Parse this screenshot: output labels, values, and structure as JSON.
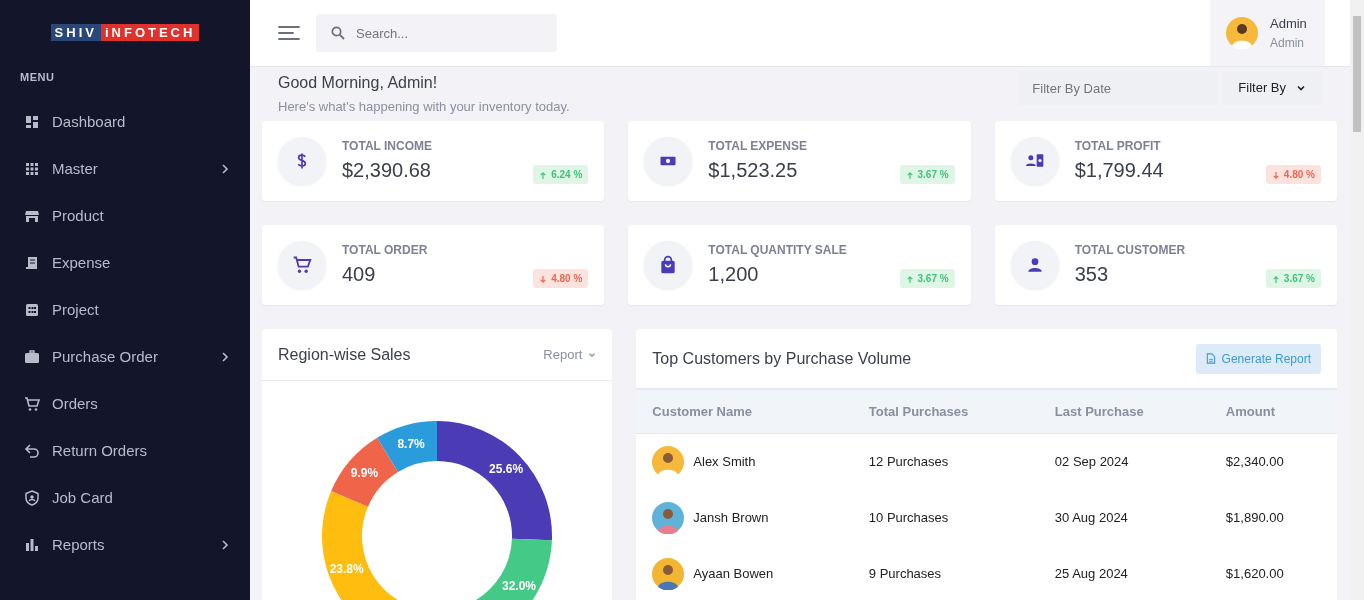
{
  "sidebar": {
    "logo": {
      "left": "SHIV",
      "right": "iNFOTECH"
    },
    "section": "MENU",
    "items": [
      {
        "label": "Dashboard",
        "submenu": false
      },
      {
        "label": "Master",
        "submenu": true
      },
      {
        "label": "Product",
        "submenu": false
      },
      {
        "label": "Expense",
        "submenu": false
      },
      {
        "label": "Project",
        "submenu": false
      },
      {
        "label": "Purchase Order",
        "submenu": true
      },
      {
        "label": "Orders",
        "submenu": false
      },
      {
        "label": "Return Orders",
        "submenu": false
      },
      {
        "label": "Job Card",
        "submenu": false
      },
      {
        "label": "Reports",
        "submenu": true
      }
    ]
  },
  "header": {
    "search": {
      "placeholder": "Search..."
    },
    "user": {
      "name": "Admin",
      "role": "Admin"
    }
  },
  "greeting": {
    "title": "Good Morning, Admin!",
    "subtitle": "Here's what's happening with your inventory today.",
    "date_filter": {
      "placeholder": "Filter By Date"
    },
    "filter_button": "Filter By"
  },
  "stats": [
    {
      "label": "TOTAL INCOME",
      "value": "$2,390.68",
      "change": "6.24 %",
      "increase": true
    },
    {
      "label": "TOTAL EXPENSE",
      "value": "$1,523.25",
      "change": "3.67 %",
      "increase": true
    },
    {
      "label": "TOTAL PROFIT",
      "value": "$1,799.44",
      "change": "4.80 %",
      "increase": false
    },
    {
      "label": "TOTAL ORDER",
      "value": "409",
      "change": "4.80 %",
      "increase": false
    },
    {
      "label": "TOTAL QUANTITY SALE",
      "value": "1,200",
      "change": "3.67 %",
      "increase": true
    },
    {
      "label": "TOTAL CUSTOMER",
      "value": "353",
      "change": "3.67 %",
      "increase": true
    }
  ],
  "region_sales": {
    "title": "Region-wise Sales",
    "menu": "Report",
    "chart_data": {
      "type": "donut",
      "values": [
        25.6,
        32.0,
        23.8,
        9.9,
        8.7
      ],
      "value_labels": [
        "25.6%",
        "32.0%",
        "23.8%",
        "9.9%",
        "8.7%"
      ]
    }
  },
  "top_customers": {
    "title": "Top Customers by Purchase Volume",
    "button": "Generate Report",
    "columns": [
      "Customer Name",
      "Total Purchases",
      "Last Purchase",
      "Amount"
    ],
    "rows": [
      {
        "name": "Alex Smith",
        "purchases": "12 Purchases",
        "last_purchase": "02 Sep 2024",
        "amount": "$2,340.00"
      },
      {
        "name": "Jansh Brown",
        "purchases": "10 Purchases",
        "last_purchase": "30 Aug 2024",
        "amount": "$1,890.00"
      },
      {
        "name": "Ayaan Bowen",
        "purchases": "9 Purchases",
        "last_purchase": "25 Aug 2024",
        "amount": "$1,620.00"
      }
    ]
  }
}
